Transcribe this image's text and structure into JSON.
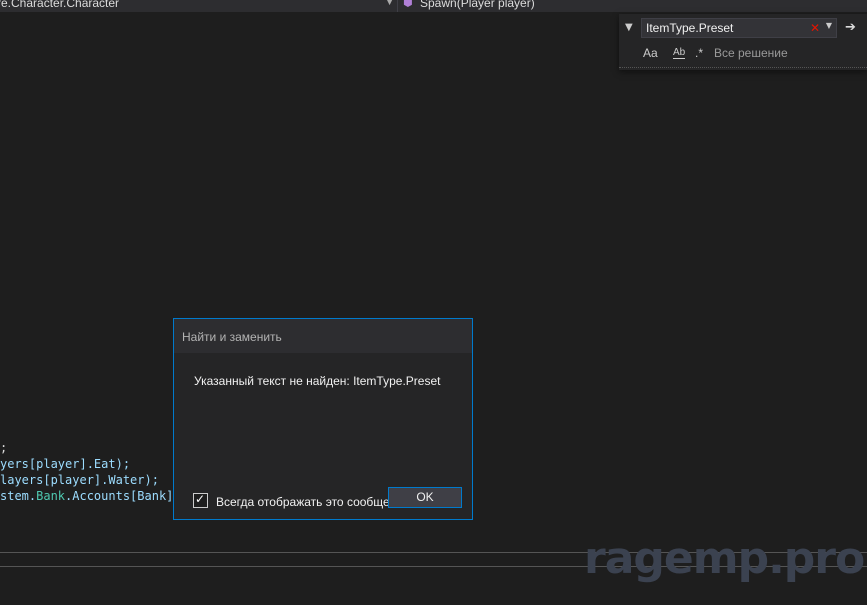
{
  "navbar": {
    "type_member": "re.Character.Character",
    "method": "Spawn(Player player)"
  },
  "find": {
    "query": "ItemType.Preset",
    "case_label": "Aa",
    "word_label": "Ab",
    "regex_label": ".*",
    "scope": "Все решение",
    "next_label": "➔"
  },
  "code": {
    "line1": ";",
    "line2": "yers[player].Eat);",
    "line3": "layers[player].Water);",
    "line4_a": "stem.",
    "line4_b": "Bank",
    "line4_c": ".Accounts[Bank]."
  },
  "dialog": {
    "title": "Найти и заменить",
    "message": "Указанный текст не найден: ItemType.Preset",
    "checkbox_label": "Всегда отображать это сообщение",
    "checked": true,
    "ok_label": "OK"
  },
  "watermark": "ragemp.pro"
}
